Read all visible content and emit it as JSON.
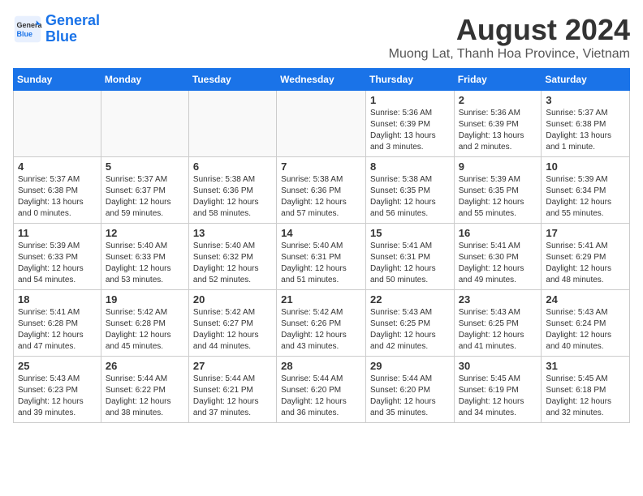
{
  "logo": {
    "line1": "General",
    "line2": "Blue"
  },
  "title": "August 2024",
  "subtitle": "Muong Lat, Thanh Hoa Province, Vietnam",
  "weekdays": [
    "Sunday",
    "Monday",
    "Tuesday",
    "Wednesday",
    "Thursday",
    "Friday",
    "Saturday"
  ],
  "weeks": [
    [
      {
        "day": "",
        "info": ""
      },
      {
        "day": "",
        "info": ""
      },
      {
        "day": "",
        "info": ""
      },
      {
        "day": "",
        "info": ""
      },
      {
        "day": "1",
        "info": "Sunrise: 5:36 AM\nSunset: 6:39 PM\nDaylight: 13 hours\nand 3 minutes."
      },
      {
        "day": "2",
        "info": "Sunrise: 5:36 AM\nSunset: 6:39 PM\nDaylight: 13 hours\nand 2 minutes."
      },
      {
        "day": "3",
        "info": "Sunrise: 5:37 AM\nSunset: 6:38 PM\nDaylight: 13 hours\nand 1 minute."
      }
    ],
    [
      {
        "day": "4",
        "info": "Sunrise: 5:37 AM\nSunset: 6:38 PM\nDaylight: 13 hours\nand 0 minutes."
      },
      {
        "day": "5",
        "info": "Sunrise: 5:37 AM\nSunset: 6:37 PM\nDaylight: 12 hours\nand 59 minutes."
      },
      {
        "day": "6",
        "info": "Sunrise: 5:38 AM\nSunset: 6:36 PM\nDaylight: 12 hours\nand 58 minutes."
      },
      {
        "day": "7",
        "info": "Sunrise: 5:38 AM\nSunset: 6:36 PM\nDaylight: 12 hours\nand 57 minutes."
      },
      {
        "day": "8",
        "info": "Sunrise: 5:38 AM\nSunset: 6:35 PM\nDaylight: 12 hours\nand 56 minutes."
      },
      {
        "day": "9",
        "info": "Sunrise: 5:39 AM\nSunset: 6:35 PM\nDaylight: 12 hours\nand 55 minutes."
      },
      {
        "day": "10",
        "info": "Sunrise: 5:39 AM\nSunset: 6:34 PM\nDaylight: 12 hours\nand 55 minutes."
      }
    ],
    [
      {
        "day": "11",
        "info": "Sunrise: 5:39 AM\nSunset: 6:33 PM\nDaylight: 12 hours\nand 54 minutes."
      },
      {
        "day": "12",
        "info": "Sunrise: 5:40 AM\nSunset: 6:33 PM\nDaylight: 12 hours\nand 53 minutes."
      },
      {
        "day": "13",
        "info": "Sunrise: 5:40 AM\nSunset: 6:32 PM\nDaylight: 12 hours\nand 52 minutes."
      },
      {
        "day": "14",
        "info": "Sunrise: 5:40 AM\nSunset: 6:31 PM\nDaylight: 12 hours\nand 51 minutes."
      },
      {
        "day": "15",
        "info": "Sunrise: 5:41 AM\nSunset: 6:31 PM\nDaylight: 12 hours\nand 50 minutes."
      },
      {
        "day": "16",
        "info": "Sunrise: 5:41 AM\nSunset: 6:30 PM\nDaylight: 12 hours\nand 49 minutes."
      },
      {
        "day": "17",
        "info": "Sunrise: 5:41 AM\nSunset: 6:29 PM\nDaylight: 12 hours\nand 48 minutes."
      }
    ],
    [
      {
        "day": "18",
        "info": "Sunrise: 5:41 AM\nSunset: 6:28 PM\nDaylight: 12 hours\nand 47 minutes."
      },
      {
        "day": "19",
        "info": "Sunrise: 5:42 AM\nSunset: 6:28 PM\nDaylight: 12 hours\nand 45 minutes."
      },
      {
        "day": "20",
        "info": "Sunrise: 5:42 AM\nSunset: 6:27 PM\nDaylight: 12 hours\nand 44 minutes."
      },
      {
        "day": "21",
        "info": "Sunrise: 5:42 AM\nSunset: 6:26 PM\nDaylight: 12 hours\nand 43 minutes."
      },
      {
        "day": "22",
        "info": "Sunrise: 5:43 AM\nSunset: 6:25 PM\nDaylight: 12 hours\nand 42 minutes."
      },
      {
        "day": "23",
        "info": "Sunrise: 5:43 AM\nSunset: 6:25 PM\nDaylight: 12 hours\nand 41 minutes."
      },
      {
        "day": "24",
        "info": "Sunrise: 5:43 AM\nSunset: 6:24 PM\nDaylight: 12 hours\nand 40 minutes."
      }
    ],
    [
      {
        "day": "25",
        "info": "Sunrise: 5:43 AM\nSunset: 6:23 PM\nDaylight: 12 hours\nand 39 minutes."
      },
      {
        "day": "26",
        "info": "Sunrise: 5:44 AM\nSunset: 6:22 PM\nDaylight: 12 hours\nand 38 minutes."
      },
      {
        "day": "27",
        "info": "Sunrise: 5:44 AM\nSunset: 6:21 PM\nDaylight: 12 hours\nand 37 minutes."
      },
      {
        "day": "28",
        "info": "Sunrise: 5:44 AM\nSunset: 6:20 PM\nDaylight: 12 hours\nand 36 minutes."
      },
      {
        "day": "29",
        "info": "Sunrise: 5:44 AM\nSunset: 6:20 PM\nDaylight: 12 hours\nand 35 minutes."
      },
      {
        "day": "30",
        "info": "Sunrise: 5:45 AM\nSunset: 6:19 PM\nDaylight: 12 hours\nand 34 minutes."
      },
      {
        "day": "31",
        "info": "Sunrise: 5:45 AM\nSunset: 6:18 PM\nDaylight: 12 hours\nand 32 minutes."
      }
    ]
  ]
}
